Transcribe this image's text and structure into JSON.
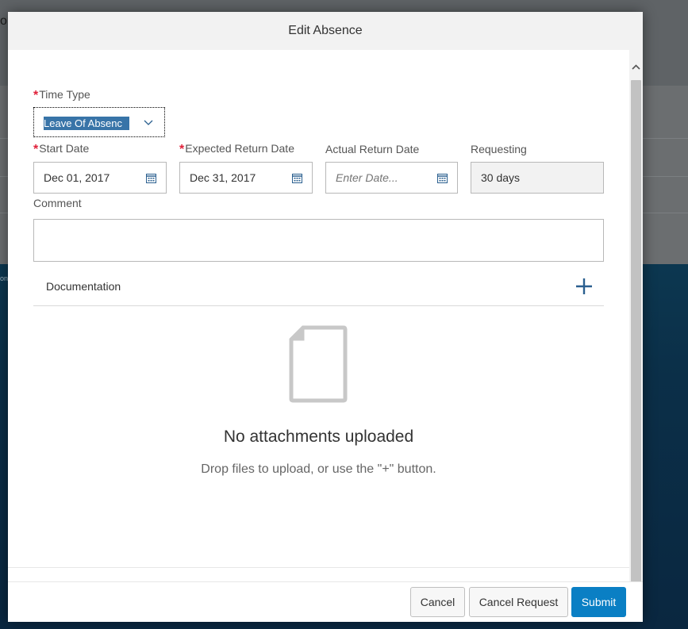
{
  "background": {
    "fragment": "o",
    "small_text": "on"
  },
  "dialog": {
    "title": "Edit Absence",
    "fields": {
      "time_type": {
        "label": "Time Type",
        "required": "*",
        "value": "Leave Of Absenc"
      },
      "start_date": {
        "label": "Start Date",
        "required": "*",
        "value": "Dec 01, 2017"
      },
      "expected_return_date": {
        "label": "Expected Return Date",
        "required": "*",
        "value": "Dec 31, 2017"
      },
      "actual_return_date": {
        "label": "Actual Return Date",
        "placeholder": "Enter Date..."
      },
      "requesting": {
        "label": "Requesting",
        "value": "30 days"
      },
      "comment": {
        "label": "Comment",
        "value": ""
      }
    },
    "documentation": {
      "title": "Documentation",
      "empty_title": "No attachments uploaded",
      "empty_subtitle": "Drop files to upload, or use the \"+\" button."
    },
    "footer": {
      "cancel": "Cancel",
      "cancel_request": "Cancel Request",
      "submit": "Submit"
    }
  },
  "colors": {
    "accent": "#0a7fc4",
    "required": "#e0213a",
    "icon": "#2a5f8f"
  },
  "icons": [
    "chevron-down-icon",
    "calendar-icon",
    "plus-icon",
    "document-icon",
    "scroll-up-icon",
    "scroll-down-icon"
  ]
}
